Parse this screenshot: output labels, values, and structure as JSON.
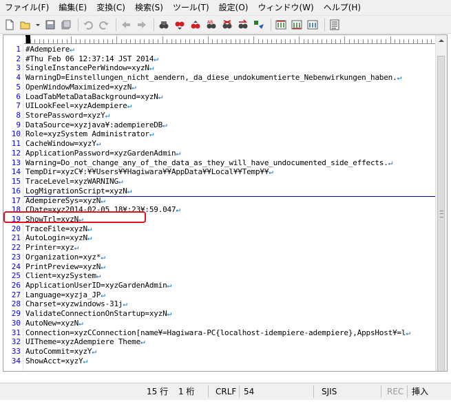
{
  "menubar": {
    "items": [
      "ファイル(F)",
      "編集(E)",
      "変換(C)",
      "検索(S)",
      "ツール(T)",
      "設定(O)",
      "ウィンドウ(W)",
      "ヘルプ(H)"
    ]
  },
  "toolbar": {
    "icons": [
      "new-file-icon",
      "open-file-icon",
      "dropdown-icon",
      "save-icon",
      "save-all-icon",
      "undo-icon",
      "redo-icon",
      "back-icon",
      "forward-icon",
      "find-icon",
      "find-next-icon",
      "find-prev-icon",
      "replace-icon",
      "grep-icon",
      "jump-icon",
      "tag-jump-icon",
      "compare-icon",
      "compare-2-icon",
      "compare-3-icon",
      "outline-icon"
    ]
  },
  "editor": {
    "line_numbers": [
      "1",
      "2",
      "3",
      "4",
      "5",
      "6",
      "7",
      "8",
      "9",
      "10",
      "11",
      "12",
      "13",
      "14",
      "15",
      "16",
      "17",
      "18",
      "19",
      "20",
      "21",
      "22",
      "23",
      "24",
      "25",
      "26",
      "27",
      "28",
      "29",
      "30",
      "31",
      "32",
      "33",
      "34"
    ],
    "lines": [
      "#Adempiere",
      "#Thu Feb 06 12:37:14 JST 2014",
      "SingleInstancePerWindow=xyzN",
      "WarningD=Einstellungen_nicht_aendern,_da_diese_undokumentierte_Nebenwirkungen_haben.",
      "OpenWindowMaximized=xyzN",
      "LoadTabMetaDataBackground=xyzN",
      "UILookFeel=xyzAdempiere",
      "StorePassword=xyzY",
      "DataSource=xyzjava¥:adempiereDB",
      "Role=xyzSystem Administrator",
      "CacheWindow=xyzY",
      "ApplicationPassword=xyzGardenAdmin",
      "Warning=Do_not_change_any_of_the_data_as_they_will_have_undocumented_side_effects.",
      "TempDir=xyzC¥:¥¥Users¥¥Hagiwara¥¥AppData¥¥Local¥¥Temp¥¥",
      "TraceLevel=xyzWARNING",
      "LogMigrationScript=xyzN",
      "AdempiereSys=xyzN",
      "CDate=xyz2014-02-05 18¥:23¥:59.047",
      "ShowTrl=xyzN",
      "TraceFile=xyzN",
      "AutoLogin=xyzN",
      "Printer=xyz",
      "Organization=xyz*",
      "PrintPreview=xyzN",
      "Client=xyzSystem",
      "ApplicationUserID=xyzGardenAdmin",
      "Language=xyzja_JP",
      "Charset=xyzwindows-31j",
      "ValidateConnectionOnStartup=xyzN",
      "AutoNew=xyzN",
      "Connection=xyzCConnection[name¥=Hagiwara-PC{localhost-idempiere-adempiere},AppsHost¥=l",
      "UITheme=xyzAdempiere Theme",
      "AutoCommit=xyzY",
      "ShowAcct=xyzY"
    ],
    "eol_marker": "↵",
    "highlight_line": 15
  },
  "statusbar": {
    "line": "15 行",
    "col": "1 桁",
    "newline": "CRLF",
    "code": "54",
    "encoding": "SJIS",
    "rec": "REC",
    "mode": "挿入"
  },
  "colors": {
    "line_number": "#0000ff",
    "eol": "#0070c0",
    "highlight": "#e01020"
  }
}
